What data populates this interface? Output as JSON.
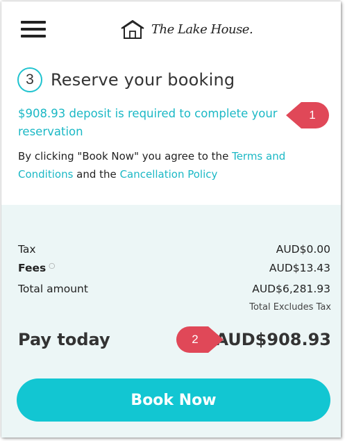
{
  "header": {
    "menu_icon": "hamburger-menu-icon",
    "logo_icon": "house-icon",
    "logo_text": "The Lake House."
  },
  "step": {
    "number": "3",
    "title": "Reserve your booking"
  },
  "deposit_notice": "$908.93 deposit is required to complete your reservation",
  "terms": {
    "prefix": "By clicking \"Book Now\" you agree to the ",
    "terms_link": "Terms and Conditions",
    "middle": " and the ",
    "policy_link": "Cancellation Policy"
  },
  "callouts": {
    "one": "1",
    "two": "2"
  },
  "summary": {
    "tax_label": "Tax",
    "tax_value": "AUD$0.00",
    "fees_label": "Fees",
    "fees_info_icon": "info-icon",
    "fees_value": "AUD$13.43",
    "total_label": "Total amount",
    "total_value": "AUD$6,281.93",
    "excludes_note": "Total Excludes Tax",
    "pay_label": "Pay today",
    "pay_value": "AUD$908.93"
  },
  "book_button": "Book Now",
  "colors": {
    "accent": "#1bb8c5",
    "button": "#12c6d2",
    "callout": "#e04858",
    "summary_bg": "#ecf6f6"
  }
}
